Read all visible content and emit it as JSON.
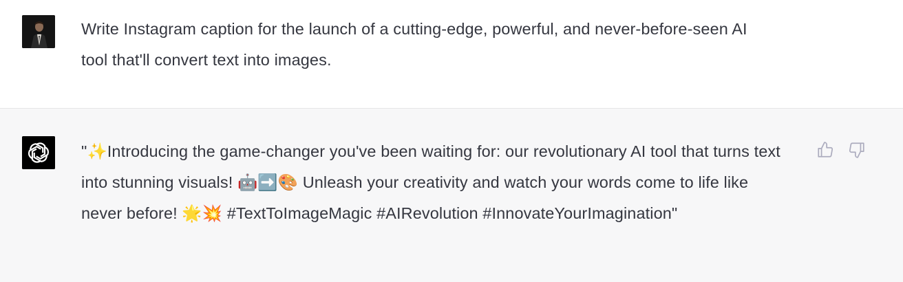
{
  "user_message": {
    "text": "Write Instagram caption for the launch of a cutting-edge, powerful, and never-before-seen AI tool that'll convert text into images."
  },
  "assistant_message": {
    "text": "\"✨Introducing the game-changer you've been waiting for: our revolutionary AI tool that turns text into stunning visuals! 🤖➡️🎨 Unleash your creativity and watch your words come to life like never before! 🌟💥 #TextToImageMagic #AIRevolution #InnovateYourImagination\""
  },
  "icons": {
    "user_avatar": "user-avatar-photo",
    "assistant_avatar": "openai-logo",
    "thumbs_up": "thumbs-up-icon",
    "thumbs_down": "thumbs-down-icon"
  },
  "colors": {
    "user_row_bg": "#ffffff",
    "assistant_row_bg": "#f7f7f8",
    "text": "#353740",
    "icon": "#acacbe"
  }
}
